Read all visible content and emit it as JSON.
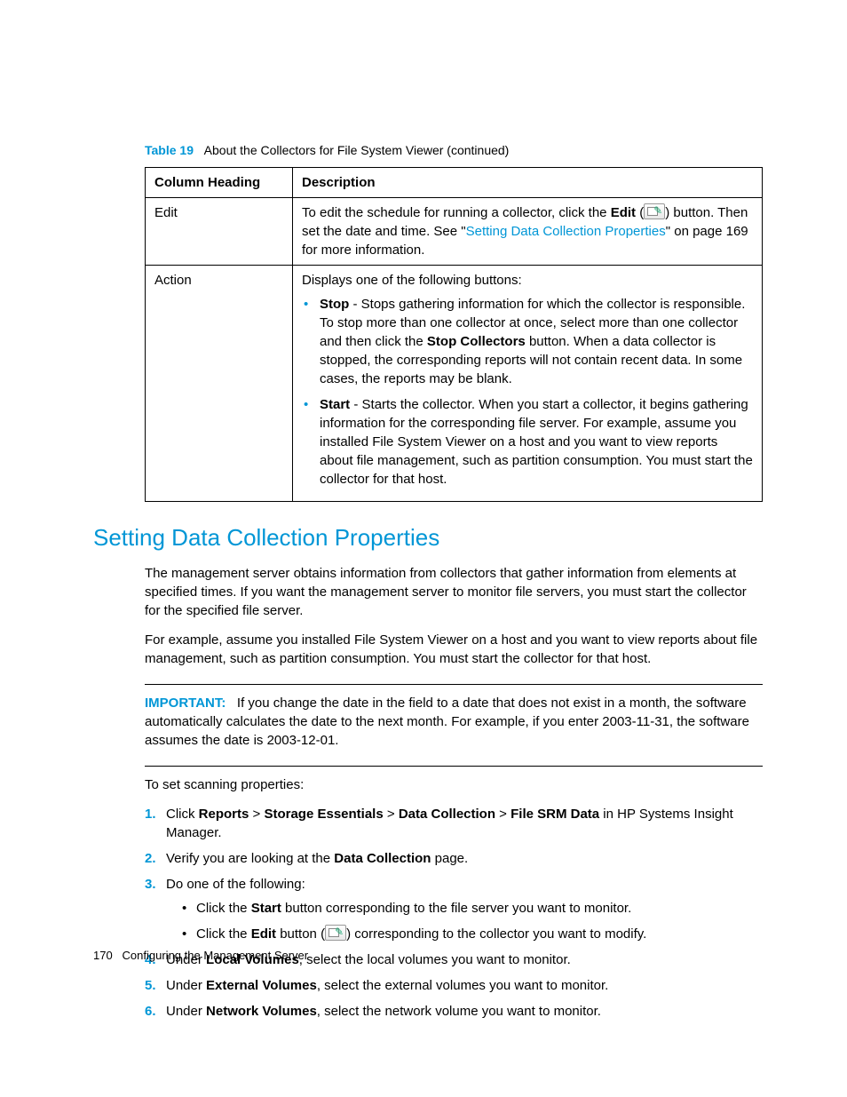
{
  "table": {
    "label": "Table 19",
    "caption": "About the Collectors for File System Viewer (continued)",
    "headers": {
      "col1": "Column Heading",
      "col2": "Description"
    },
    "rows": {
      "edit": {
        "heading": "Edit",
        "desc_pre": "To edit the schedule for running a collector, click the ",
        "edit_bold": "Edit",
        "desc_mid": " (",
        "desc_after_icon": ") button. Then set the date and time. See \"",
        "link": "Setting Data Collection Properties",
        "desc_end": "\" on page 169 for more information."
      },
      "action": {
        "heading": "Action",
        "intro": "Displays one of the following buttons:",
        "stop_bold": "Stop",
        "stop_text": " - Stops gathering information for which the collector is responsible. To stop more than one collector at once, select more than one collector and then click the ",
        "stop_btn_bold": "Stop Collectors",
        "stop_text2": " button. When a data collector is stopped, the corresponding reports will not contain recent data. In some cases, the reports may be blank.",
        "start_bold": "Start",
        "start_text": " - Starts the collector. When you start a collector, it begins gathering information for the corresponding file server. For example, assume you installed File System Viewer on a host and you want to view reports about file management, such as partition consumption. You must start the collector for that host."
      }
    }
  },
  "section_title": "Setting Data Collection Properties",
  "para1": "The management server obtains information from collectors that gather information from elements at specified times. If you want the management server to monitor file servers, you must start the collector for the specified file server.",
  "para2": "For example, assume you installed File System Viewer on a host and you want to view reports about file management, such as partition consumption. You must start the collector for that host.",
  "important_label": "IMPORTANT:",
  "important_text": "If you change the date in the field to a date that does not exist in a month, the software automatically calculates the date to the next month. For example, if you enter 2003-11-31, the software assumes the date is 2003-12-01.",
  "steps_intro": "To set scanning properties:",
  "steps": {
    "s1": {
      "num": "1.",
      "pre": "Click ",
      "b1": "Reports",
      "gt1": " > ",
      "b2": "Storage Essentials",
      "gt2": " > ",
      "b3": "Data Collection",
      "gt3": " > ",
      "b4": "File SRM Data",
      "post": " in HP Systems Insight Manager."
    },
    "s2": {
      "num": "2.",
      "pre": "Verify you are looking at the ",
      "b": "Data Collection",
      "post": " page."
    },
    "s3": {
      "num": "3.",
      "text": "Do one of the following:",
      "sub1_pre": "Click the ",
      "sub1_b": "Start",
      "sub1_post": " button corresponding to the file server you want to monitor.",
      "sub2_pre": "Click the ",
      "sub2_b": "Edit",
      "sub2_mid": " button (",
      "sub2_post": ") corresponding to the collector you want to modify."
    },
    "s4": {
      "num": "4.",
      "pre": "Under ",
      "b": "Local Volumes",
      "post": ", select the local volumes you want to monitor."
    },
    "s5": {
      "num": "5.",
      "pre": "Under ",
      "b": "External Volumes",
      "post": ", select the external volumes you want to monitor."
    },
    "s6": {
      "num": "6.",
      "pre": "Under ",
      "b": "Network Volumes",
      "post": ", select the network volume you want to monitor."
    }
  },
  "footer": {
    "pagenum": "170",
    "title": "Configuring the Management Server"
  }
}
